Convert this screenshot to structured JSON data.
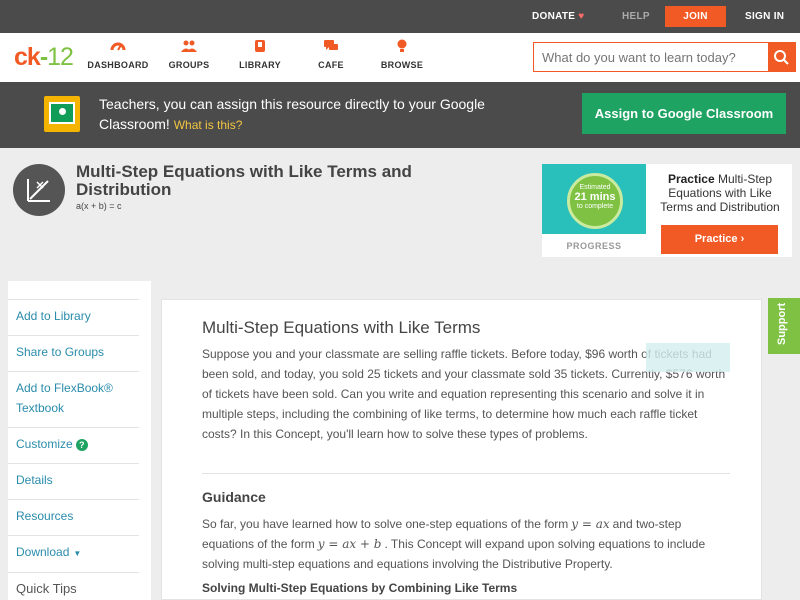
{
  "topbar": {
    "donate": "DONATE",
    "help": "HELP",
    "join": "JOIN",
    "signin": "SIGN IN"
  },
  "logo": {
    "ck": "ck",
    "dash": "-",
    "num": "12"
  },
  "nav": {
    "items": [
      {
        "label": "DASHBOARD",
        "icon": "dashboard-icon"
      },
      {
        "label": "GROUPS",
        "icon": "groups-icon"
      },
      {
        "label": "LIBRARY",
        "icon": "library-icon"
      },
      {
        "label": "CAFE",
        "icon": "cafe-icon"
      },
      {
        "label": "BROWSE",
        "icon": "browse-icon"
      }
    ]
  },
  "search": {
    "placeholder": "What do you want to learn today?"
  },
  "banner": {
    "text": "Teachers, you can assign this resource directly to your Google Classroom!",
    "what": "What is this?",
    "button": "Assign to Google Classroom"
  },
  "concept": {
    "title": "Multi-Step Equations with Like Terms and Distribution",
    "subtitle": "a(x + b) = c"
  },
  "practice": {
    "estimated": "Estimated",
    "mins": "21 mins",
    "to_complete": "to complete",
    "progress": "PROGRESS",
    "title_bold": "Practice",
    "title_rest": "Multi-Step Equations with Like Terms and Distribution",
    "button": "Practice"
  },
  "sidebar": {
    "items": [
      {
        "label": "Add to Library"
      },
      {
        "label": "Share to Groups"
      },
      {
        "label": "Add to FlexBook® Textbook"
      },
      {
        "label": "Customize",
        "badge": "?"
      },
      {
        "label": "Details"
      },
      {
        "label": "Resources"
      },
      {
        "label": "Download",
        "caret": "▼"
      },
      {
        "label": "Quick Tips"
      }
    ]
  },
  "content": {
    "heading": "Multi-Step Equations with Like Terms",
    "intro": "Suppose you and your classmate are selling raffle tickets. Before today, $96 worth of tickets had been sold, and today, you sold 25 tickets and your classmate sold 35 tickets. Currently, $576 worth of tickets have been sold. Can you write and equation representing this scenario and solve it in multiple steps, including the combining of like terms, to determine how much each raffle ticket costs? In this Concept, you'll learn how to solve these types of problems.",
    "guidance_heading": "Guidance",
    "guidance_a": "So far, you have learned how to solve one-step equations of the form",
    "eq1": "y = ax",
    "guidance_b": "and two-step equations of the form",
    "eq2": "y = ax + b",
    "guidance_c": ". This Concept will expand upon solving equations to include solving multi-step equations and equations involving the Distributive Property.",
    "subheading": "Solving Multi-Step Equations by Combining Like Terms"
  },
  "support": {
    "label": "Support"
  },
  "colors": {
    "accent": "#f15a24",
    "green": "#1ea362",
    "lime": "#7fc243",
    "link": "#2a8cab",
    "dark": "#4b4b4b"
  }
}
